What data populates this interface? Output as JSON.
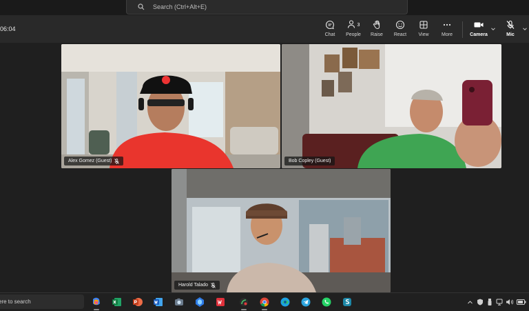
{
  "search": {
    "placeholder": "Search (Ctrl+Alt+E)"
  },
  "meeting": {
    "timer": "06:04",
    "toolbar": {
      "chat": "Chat",
      "people": "People",
      "people_count": "3",
      "raise": "Raise",
      "react": "React",
      "view": "View",
      "more": "More",
      "camera": "Camera",
      "mic": "Mic"
    },
    "participants": [
      {
        "name": "Alex Gomez (Guest)"
      },
      {
        "name": "Bob Copley (Guest)"
      },
      {
        "name": "Harold Talado"
      }
    ]
  },
  "taskbar": {
    "search_text": "ere to search",
    "apps": [
      "copilot-icon",
      "excel-icon",
      "powerpoint-icon",
      "word-icon",
      "camera-app-icon",
      "vpn-icon",
      "wps-icon",
      "browser-icon",
      "chrome-icon",
      "edge-icon",
      "telegram-icon",
      "whatsapp-icon",
      "app-s-icon"
    ]
  },
  "colors": {
    "toolbar_bg": "#292929",
    "stage_bg": "#1f1f1f",
    "taskbar_bg": "#202020"
  }
}
